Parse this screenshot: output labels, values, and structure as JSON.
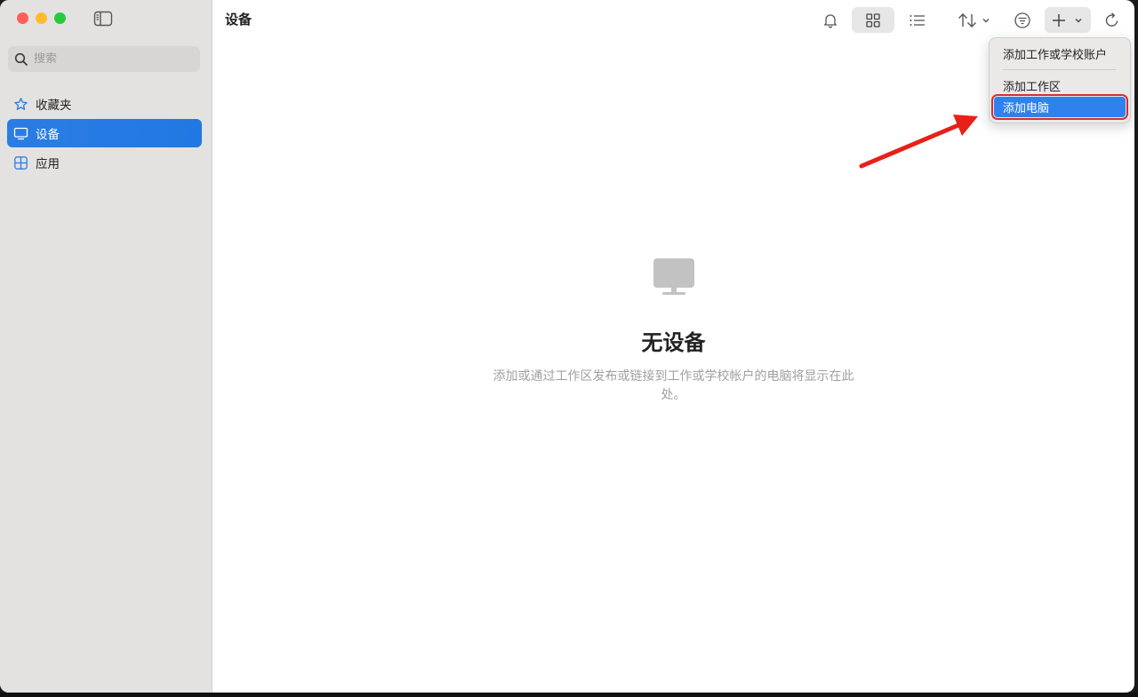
{
  "sidebar": {
    "search_placeholder": "搜索",
    "items": [
      {
        "label": "收藏夹",
        "icon": "star-icon"
      },
      {
        "label": "设备",
        "icon": "display-icon",
        "active": true
      },
      {
        "label": "应用",
        "icon": "apps-grid-icon"
      }
    ]
  },
  "header": {
    "title": "设备",
    "toolbar_icons": [
      "bell-icon",
      "grid-view-icon",
      "list-view-icon",
      "sort-icon",
      "filter-icon",
      "add-icon",
      "refresh-icon"
    ]
  },
  "empty_state": {
    "icon": "display-icon",
    "title": "无设备",
    "description": "添加或通过工作区发布或链接到工作或学校帐户的电脑将显示在此处。"
  },
  "add_menu": {
    "items": [
      "添加工作或学校账户",
      "添加工作区",
      "添加电脑"
    ],
    "highlighted": "添加电脑"
  },
  "colors": {
    "accent": "#2a7de4",
    "sidebar_bg": "#e4e2e1",
    "highlight_outline": "#d32f2f",
    "annotation_arrow": "#e8201a"
  }
}
